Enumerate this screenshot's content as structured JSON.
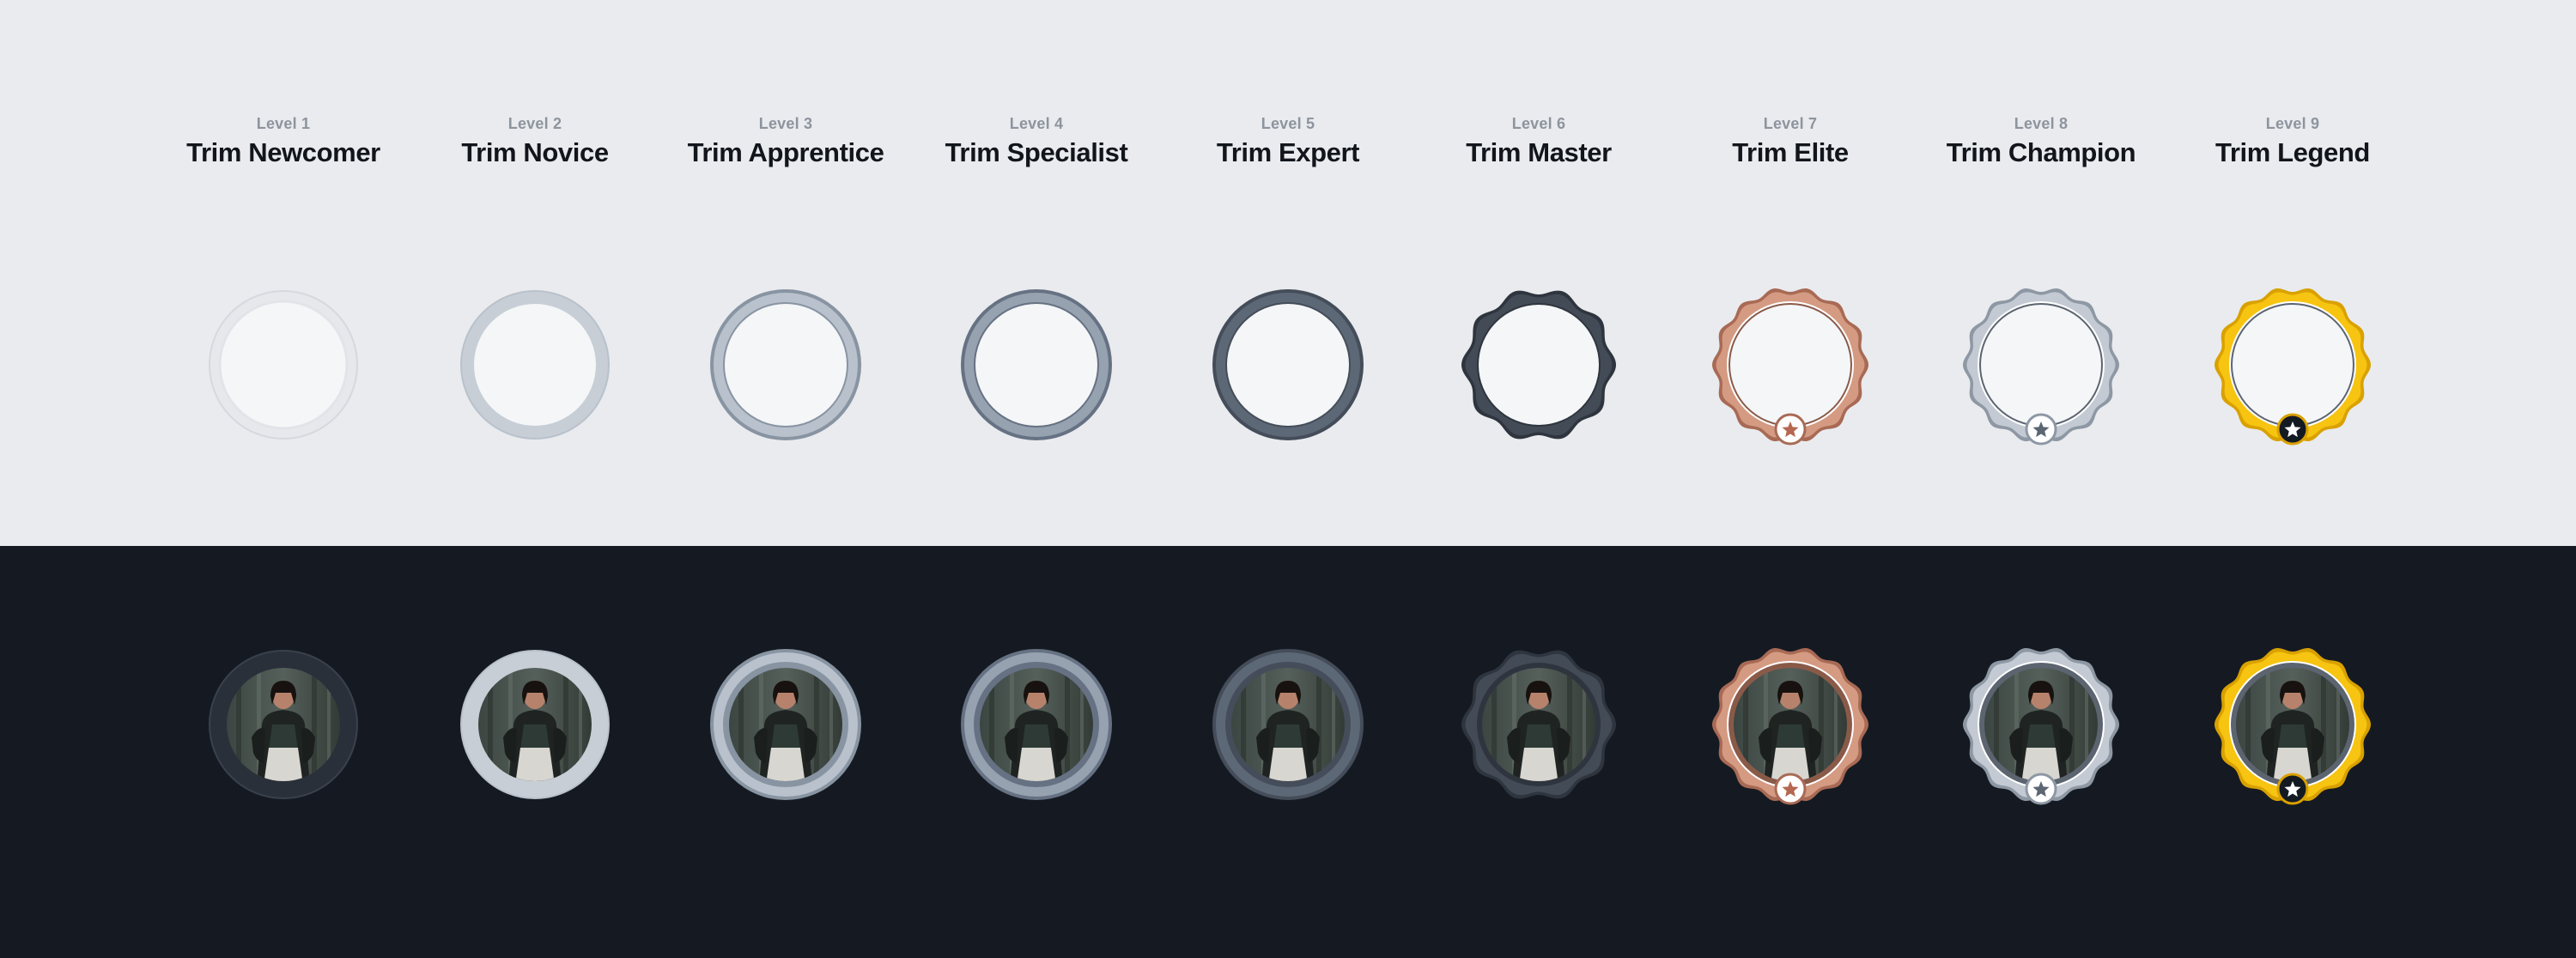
{
  "levels": [
    {
      "level": "Level 1",
      "name": "Trim Newcomer",
      "tier": "plain",
      "ring": "#e6e8eb",
      "ring_dark": "#2a303a",
      "edge": "#d5d9de",
      "star": false
    },
    {
      "level": "Level 2",
      "name": "Trim Novice",
      "tier": "plain",
      "ring": "#c8ced6",
      "ring_dark": "#c8ced6",
      "edge": "#b9c1cb",
      "star": false
    },
    {
      "level": "Level 3",
      "name": "Trim Apprentice",
      "tier": "double",
      "ring": "#b8c1cc",
      "ring_dark": "#b8c1cc",
      "edge": "#8894a2",
      "star": false
    },
    {
      "level": "Level 4",
      "name": "Trim Specialist",
      "tier": "double",
      "ring": "#96a2b0",
      "ring_dark": "#96a2b0",
      "edge": "#667283",
      "star": false
    },
    {
      "level": "Level 5",
      "name": "Trim Expert",
      "tier": "double",
      "ring": "#5d6877",
      "ring_dark": "#5d6877",
      "edge": "#444d59",
      "star": false
    },
    {
      "level": "Level 6",
      "name": "Trim Master",
      "tier": "wavy",
      "ring": "#434b57",
      "ring_dark": "#434b57",
      "edge": "#2f353e",
      "star": false
    },
    {
      "level": "Level 7",
      "name": "Trim Elite",
      "tier": "medal",
      "ring": "#d49a82",
      "ring_dark": "#d49a82",
      "edge": "#a86a55",
      "star": true,
      "star_color": "#b5674f",
      "star_bg": "#ffffff"
    },
    {
      "level": "Level 8",
      "name": "Trim Champion",
      "tier": "medal",
      "ring": "#c3cad3",
      "ring_dark": "#c3cad3",
      "edge": "#8e98a4",
      "star": true,
      "star_color": "#5c6673",
      "star_bg": "#ffffff"
    },
    {
      "level": "Level 9",
      "name": "Trim Legend",
      "tier": "medal",
      "ring": "#f6c411",
      "ring_dark": "#f6c411",
      "edge": "#d9a100",
      "star": true,
      "star_color": "#ffffff",
      "star_bg": "#141a22"
    }
  ],
  "icons": {
    "avatar": "avatar-photo",
    "star": "star-icon"
  },
  "colors": {
    "light_bg": "#e9ebee",
    "dark_bg": "#151a22",
    "inner_fill": "#f4f6f8"
  }
}
